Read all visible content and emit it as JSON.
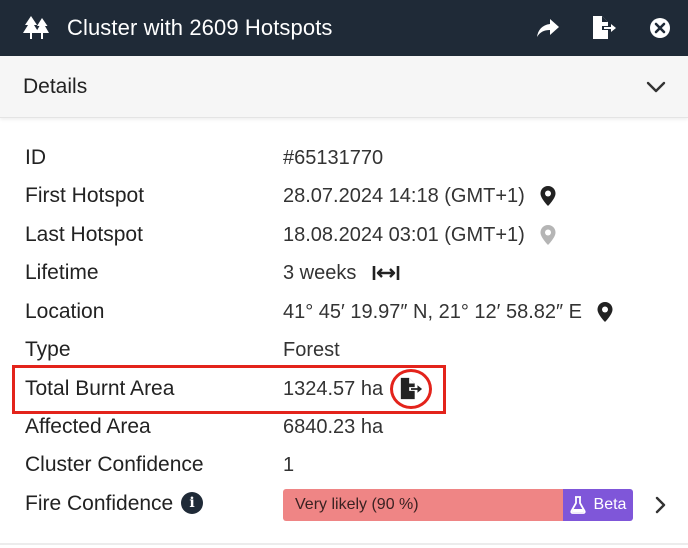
{
  "header": {
    "title": "Cluster with 2609 Hotspots",
    "icons": [
      "trees-icon",
      "share-icon",
      "export-icon",
      "close-icon"
    ],
    "background": "#1f2a37"
  },
  "details": {
    "title": "Details",
    "expanded": true
  },
  "rows": [
    {
      "label": "ID",
      "value": "#65131770"
    },
    {
      "label": "First Hotspot",
      "value": "28.07.2024 14:18 (GMT+1)",
      "icon": "location-pin-icon"
    },
    {
      "label": "Last Hotspot",
      "value": "18.08.2024 03:01 (GMT+1)",
      "icon": "location-pin-icon"
    },
    {
      "label": "Lifetime",
      "value": "3 weeks",
      "icon": "arrows-horizontal-icon"
    },
    {
      "label": "Location",
      "value": "41° 45′ 19.97″ N, 21° 12′ 58.82″ E",
      "icon": "location-pin-icon"
    },
    {
      "label": "Type",
      "value": "Forest"
    },
    {
      "label": "Total Burnt Area",
      "value": "1324.57 ha",
      "icon": "export-icon"
    },
    {
      "label": "Affected Area",
      "value": "6840.23 ha"
    },
    {
      "label": "Cluster Confidence",
      "value": "1"
    },
    {
      "label": "Fire Confidence",
      "icon": "info-icon"
    }
  ],
  "fire_confidence": {
    "label": "Very likely (90 %)",
    "fraction": 0.9,
    "badge": "Beta",
    "fill_color": "#ef8585",
    "badge_color": "#7f56d9"
  },
  "highlight_color": "#e3231b"
}
